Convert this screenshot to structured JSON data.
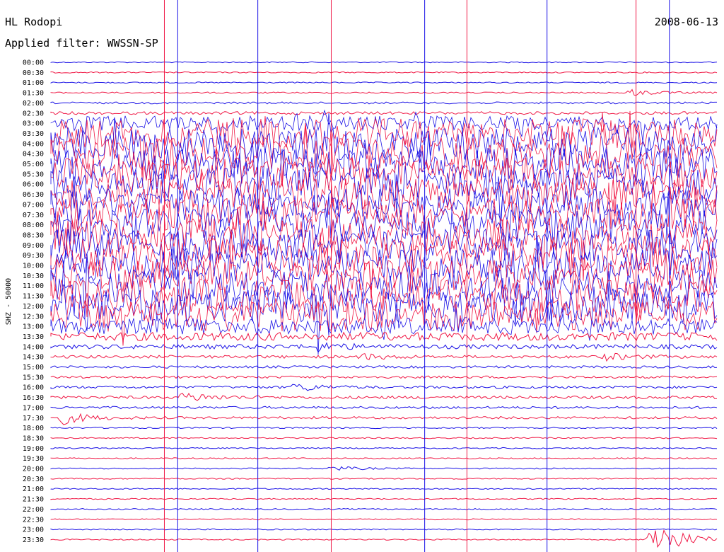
{
  "header": {
    "station": "HL Rodopi",
    "filter": "Applied filter: WWSSN-SP",
    "date": "2008-06-13",
    "channel_label": "SHZ - 50000"
  },
  "colors": {
    "trace_a": "#1b12e6",
    "trace_b": "#f01845",
    "background": "#ffffff"
  },
  "chart_data": {
    "type": "line",
    "time_unit": "minutes",
    "minutes_per_line": 30,
    "series_colors": "alternating trace_a / trace_b per 30-minute line",
    "tick_labels": [
      "00:00",
      "00:30",
      "01:00",
      "01:30",
      "02:00",
      "02:30",
      "03:00",
      "03:30",
      "04:00",
      "04:30",
      "05:00",
      "05:30",
      "06:00",
      "06:30",
      "07:00",
      "07:30",
      "08:00",
      "08:30",
      "09:00",
      "09:30",
      "10:00",
      "10:30",
      "11:00",
      "11:30",
      "12:00",
      "12:30",
      "13:00",
      "13:30",
      "14:00",
      "14:30",
      "15:00",
      "15:30",
      "16:00",
      "16:30",
      "17:00",
      "17:30",
      "18:00",
      "18:30",
      "19:00",
      "19:30",
      "20:00",
      "20:30",
      "21:00",
      "21:30",
      "22:00",
      "22:30",
      "23:00",
      "23:30"
    ],
    "line_activity": [
      0.04,
      0.05,
      0.05,
      0.06,
      0.08,
      0.12,
      0.45,
      0.9,
      1.0,
      1.0,
      1.0,
      1.0,
      1.0,
      1.0,
      1.0,
      1.0,
      1.0,
      1.0,
      1.0,
      1.0,
      1.0,
      1.0,
      1.0,
      1.0,
      1.0,
      0.95,
      0.5,
      0.25,
      0.18,
      0.12,
      0.1,
      0.1,
      0.1,
      0.12,
      0.1,
      0.1,
      0.06,
      0.05,
      0.05,
      0.05,
      0.05,
      0.05,
      0.05,
      0.05,
      0.05,
      0.05,
      0.05,
      0.05
    ],
    "events": [
      {
        "line": 3,
        "minute": 26,
        "amplitude": 0.3
      },
      {
        "line": 28,
        "minute": 12,
        "amplitude": 0.35
      },
      {
        "line": 29,
        "minute": 14,
        "amplitude": 0.25
      },
      {
        "line": 29,
        "minute": 25,
        "amplitude": 0.3
      },
      {
        "line": 32,
        "minute": 11,
        "amplitude": 0.4
      },
      {
        "line": 33,
        "minute": 6,
        "amplitude": 0.45
      },
      {
        "line": 35,
        "minute": 0.5,
        "amplitude": 0.6
      },
      {
        "line": 40,
        "minute": 12.5,
        "amplitude": 0.25
      },
      {
        "line": 47,
        "minute": 27,
        "amplitude": 2.2
      }
    ],
    "spikes_minutes": [
      5.7,
      5.1,
      9.3,
      12.6,
      16.8,
      18.7,
      22.3,
      26.3,
      27.8
    ]
  }
}
